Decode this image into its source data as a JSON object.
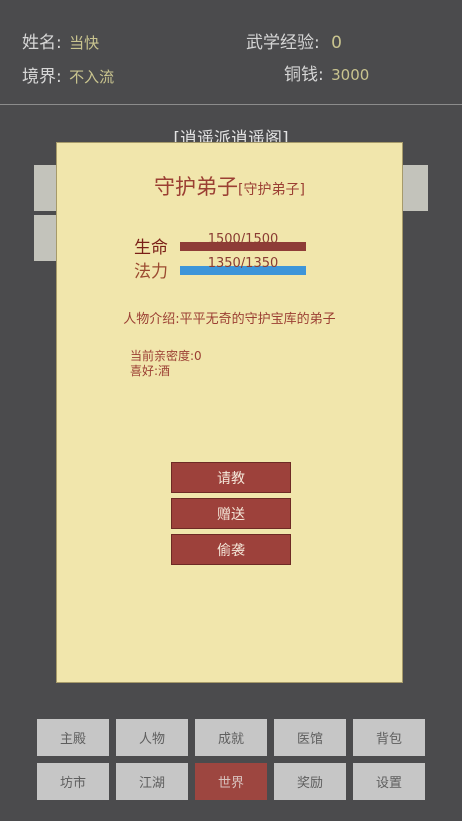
{
  "header": {
    "name_label": "姓名:",
    "name_value": "当快",
    "exp_label": "武学经验:",
    "exp_value": "0",
    "realm_label": "境界:",
    "realm_value": "不入流",
    "money_label": "铜钱:",
    "money_value": "3000"
  },
  "place_title": "[逍遥派逍遥阁]",
  "dialog": {
    "name": "守护弟子",
    "tag": "[守护弟子]",
    "hp_label": "生命",
    "hp_text": "1500/1500",
    "hp_fraction": 1.0,
    "mp_label": "法力",
    "mp_text": "1350/1350",
    "mp_fraction": 1.0,
    "intro": "人物介绍:平平无奇的守护宝库的弟子",
    "intimacy": "当前亲密度:0",
    "preference": "喜好:酒",
    "buttons": [
      "请教",
      "赠送",
      "偷袭"
    ]
  },
  "nav": {
    "row1": [
      "主殿",
      "人物",
      "成就",
      "医馆",
      "背包"
    ],
    "row2": [
      "坊市",
      "江湖",
      "世界",
      "奖励",
      "设置"
    ],
    "active": "世界"
  },
  "colors": {
    "background": "#4b4b4d",
    "modal": "#f1e6ac",
    "accent": "#9d413b",
    "hp_bar": "#8e3c37",
    "mp_bar": "#3d95d9",
    "nav_button": "#c6c6c6"
  }
}
